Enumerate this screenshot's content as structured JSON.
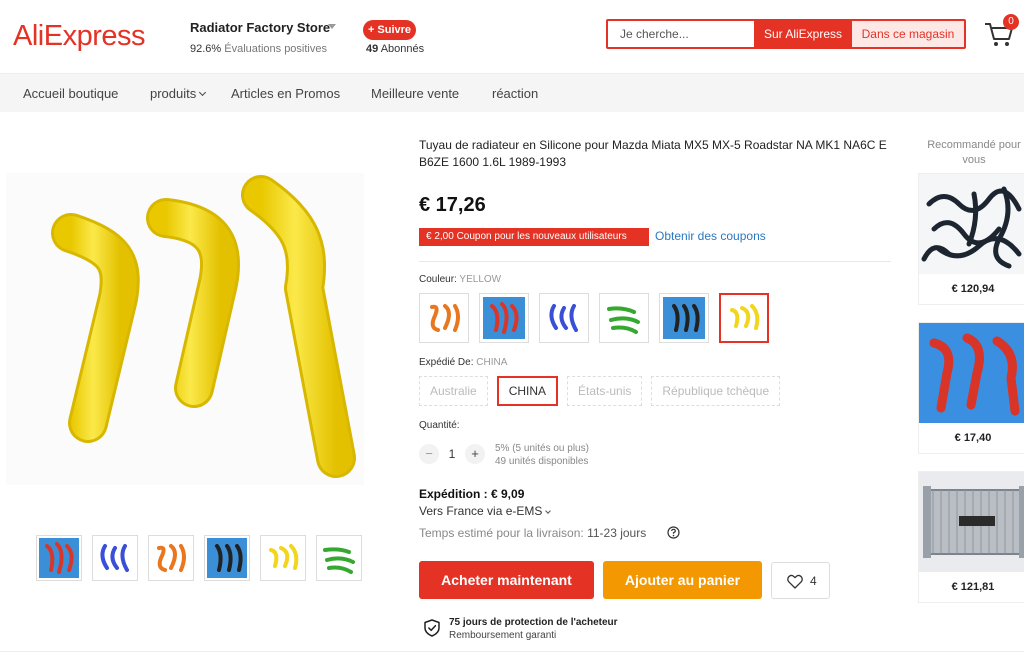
{
  "header": {
    "logo": "AliExpress",
    "store_name": "Radiator Factory Store",
    "rating_value": "92.6%",
    "rating_label": "Évaluations positives",
    "follow_label": "+ Suivre",
    "followers_count": "49",
    "followers_label": "Abonnés",
    "search_placeholder": "Je cherche...",
    "search_ae_label": "Sur AliExpress",
    "search_store_label": "Dans ce magasin",
    "cart_count": "0"
  },
  "nav": {
    "items": [
      "Accueil boutique",
      "produits",
      "Articles en Promos",
      "Meilleure vente",
      "réaction"
    ]
  },
  "product": {
    "title": "Tuyau de radiateur en Silicone pour Mazda Miata MX5 MX-5 Roadstar NA MK1 NA6C E B6ZE 1600 1.6L 1989-1993",
    "price": "€ 17,26",
    "coupon": "€ 2,00 Coupon pour les nouveaux utilisateurs",
    "get_coupons": "Obtenir des coupons",
    "color_label": "Couleur:",
    "color_value": "YELLOW",
    "colors": [
      "orange",
      "red",
      "blue",
      "green",
      "black",
      "yellow"
    ],
    "ship_from_label": "Expédié De:",
    "ship_from_value": "CHINA",
    "ship_from_options": [
      "Australie",
      "CHINA",
      "États-unis",
      "République tchèque"
    ],
    "quantity_label": "Quantité:",
    "quantity": "1",
    "discount_note": "5% (5 unités ou plus)",
    "stock_note": "49 unités disponibles",
    "shipping_cost": "Expédition : € 9,09",
    "shipping_via": "Vers France via e-EMS",
    "delivery_label": "Temps estimé pour la livraison:",
    "delivery_value": "11-23 jours",
    "buy_label": "Acheter maintenant",
    "cart_label": "Ajouter au panier",
    "wish_count": "4",
    "protection_title": "75 jours de protection de l'acheteur",
    "protection_sub": "Remboursement garanti"
  },
  "thumbnails": [
    "red",
    "blue",
    "orange",
    "black",
    "yellow",
    "green"
  ],
  "recommendations": {
    "title": "Recommandé pour vous",
    "items": [
      {
        "price": "€ 120,94",
        "kind": "black hoses"
      },
      {
        "price": "€ 17,40",
        "kind": "red hoses"
      },
      {
        "price": "€ 121,81",
        "kind": "radiator"
      }
    ]
  },
  "colors": {
    "accent": "#e43225",
    "orange_button": "#f39800",
    "link": "#2a78c2",
    "yellow_hose": "#f6df1f"
  }
}
